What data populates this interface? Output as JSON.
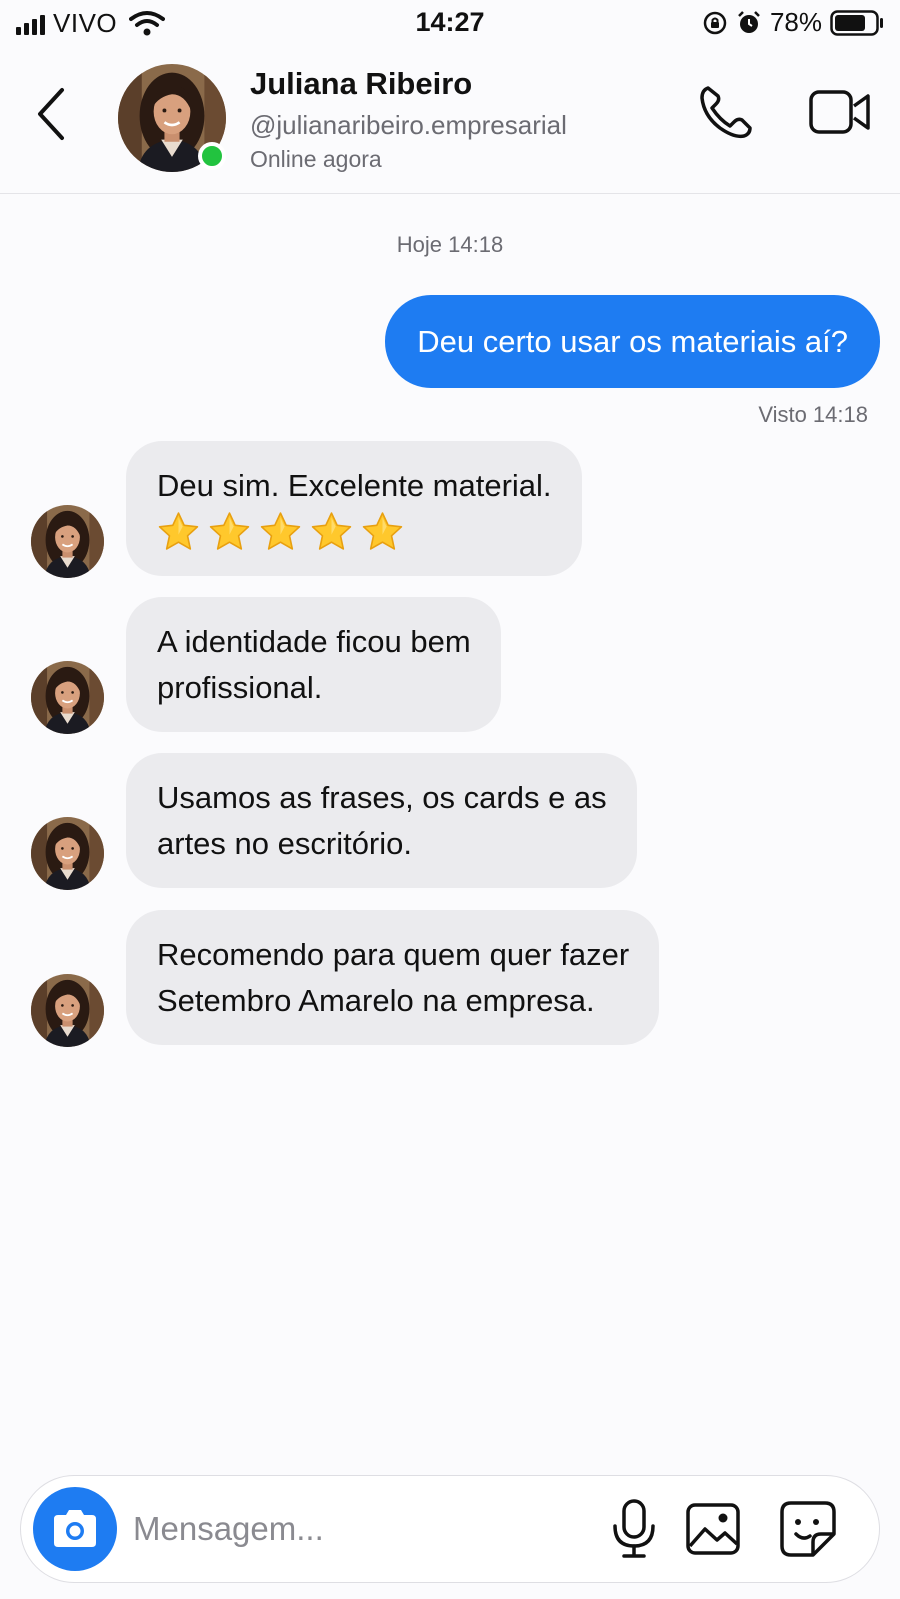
{
  "status_bar": {
    "carrier": "VIVO",
    "time": "14:27",
    "battery_percent": "78%",
    "battery_level": 0.78,
    "icons": [
      "signal-icon",
      "wifi-icon",
      "orientation-lock-icon",
      "alarm-icon",
      "battery-icon"
    ]
  },
  "header": {
    "name": "Juliana Ribeiro",
    "handle": "@julianaribeiro.empresarial",
    "status": "Online agora",
    "online_color": "#22c33f",
    "icons": [
      "back-chevron-icon",
      "phone-icon",
      "video-camera-icon"
    ]
  },
  "chat": {
    "date_label": "Hoje 14:18",
    "outgoing": {
      "text": "Deu certo usar os materiais aí?",
      "seen": "Visto 14:18",
      "color": "#1e7cf2"
    },
    "incoming": [
      {
        "text": "Deu sim. Excelente material.",
        "stars": 5
      },
      {
        "lines": [
          "A identidade ficou bem",
          "profissional."
        ]
      },
      {
        "lines": [
          "Usamos as frases, os cards e as",
          "artes no escritório."
        ]
      },
      {
        "lines": [
          "Recomendo para quem quer fazer",
          "Setembro Amarelo na empresa."
        ]
      }
    ]
  },
  "composer": {
    "placeholder": "Mensagem...",
    "icons": [
      "camera-icon",
      "microphone-icon",
      "image-icon",
      "sticker-icon"
    ]
  }
}
